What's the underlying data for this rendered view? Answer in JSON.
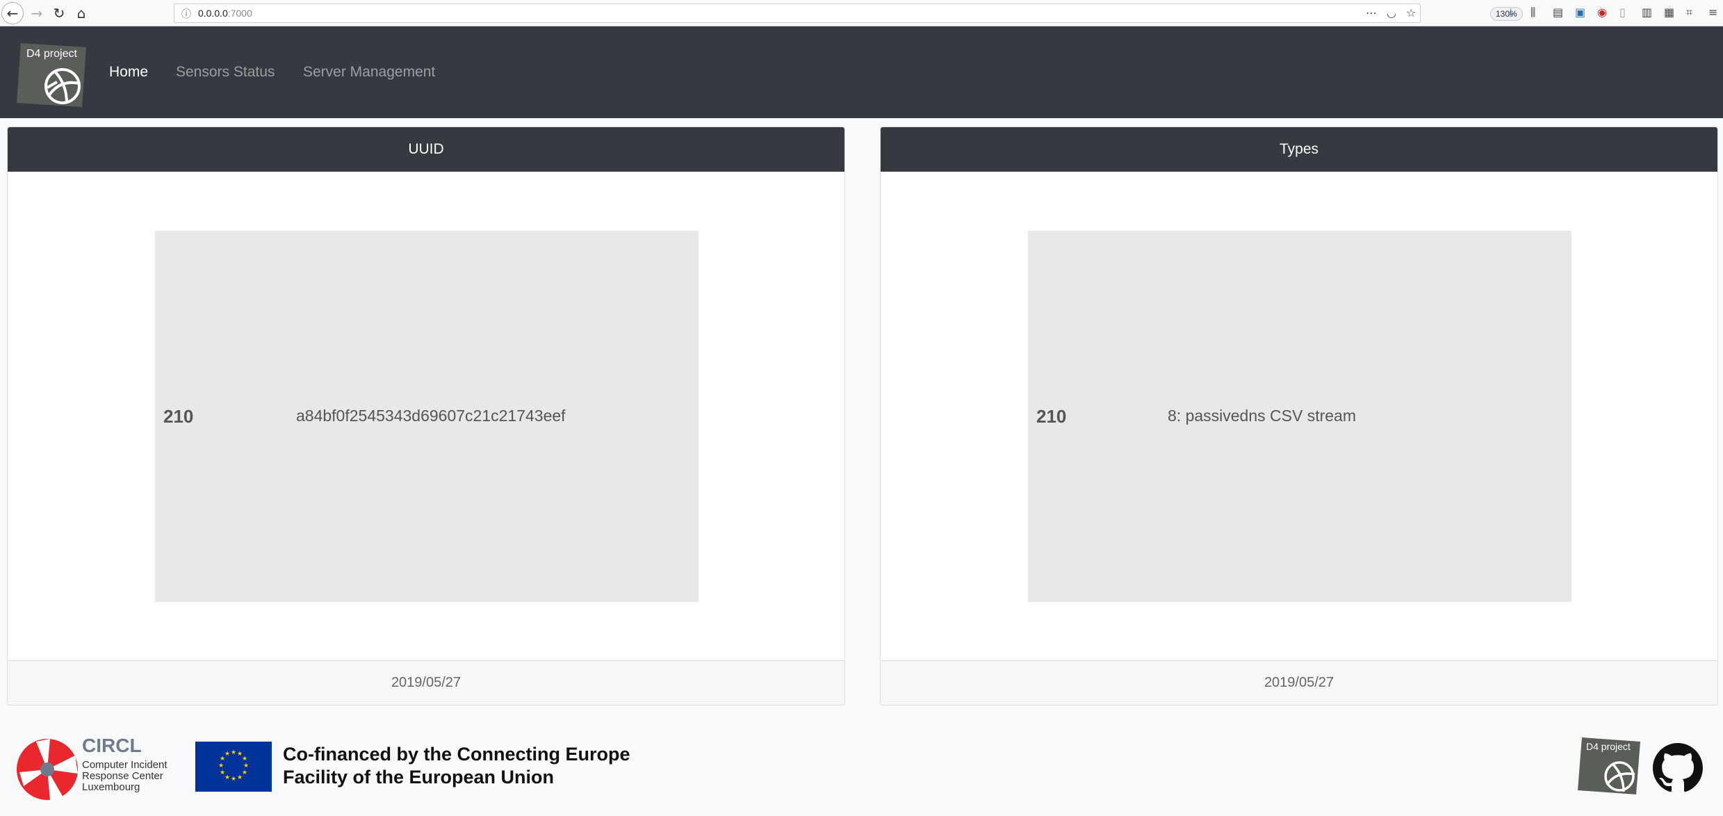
{
  "browser": {
    "url_host": "0.0.0.0",
    "url_port": ":7000",
    "zoom": "130%"
  },
  "navbar": {
    "logo_text": "D4 project",
    "links": [
      {
        "label": "Home",
        "active": true
      },
      {
        "label": "Sensors Status",
        "active": false
      },
      {
        "label": "Server Management",
        "active": false
      }
    ]
  },
  "cards": [
    {
      "header": "UUID",
      "count": "210",
      "label": "a84bf0f2545343d69607c21c21743eef",
      "footer": "2019/05/27"
    },
    {
      "header": "Types",
      "count": "210",
      "label": "8: passivedns CSV stream",
      "footer": "2019/05/27"
    }
  ],
  "footer": {
    "circl_name": "CIRCL",
    "circl_sub_1": "Computer Incident",
    "circl_sub_2": "Response Center",
    "circl_sub_3": "Luxembourg",
    "cofinanced_1": "Co-financed by the Connecting Europe",
    "cofinanced_2": "Facility of the European Union",
    "d4_logo_text": "D4 project"
  },
  "colors": {
    "navbar_bg": "#343a40",
    "chart_bg": "#e8e8e8",
    "eu_blue": "#003399",
    "circl_red": "#e8282e"
  }
}
